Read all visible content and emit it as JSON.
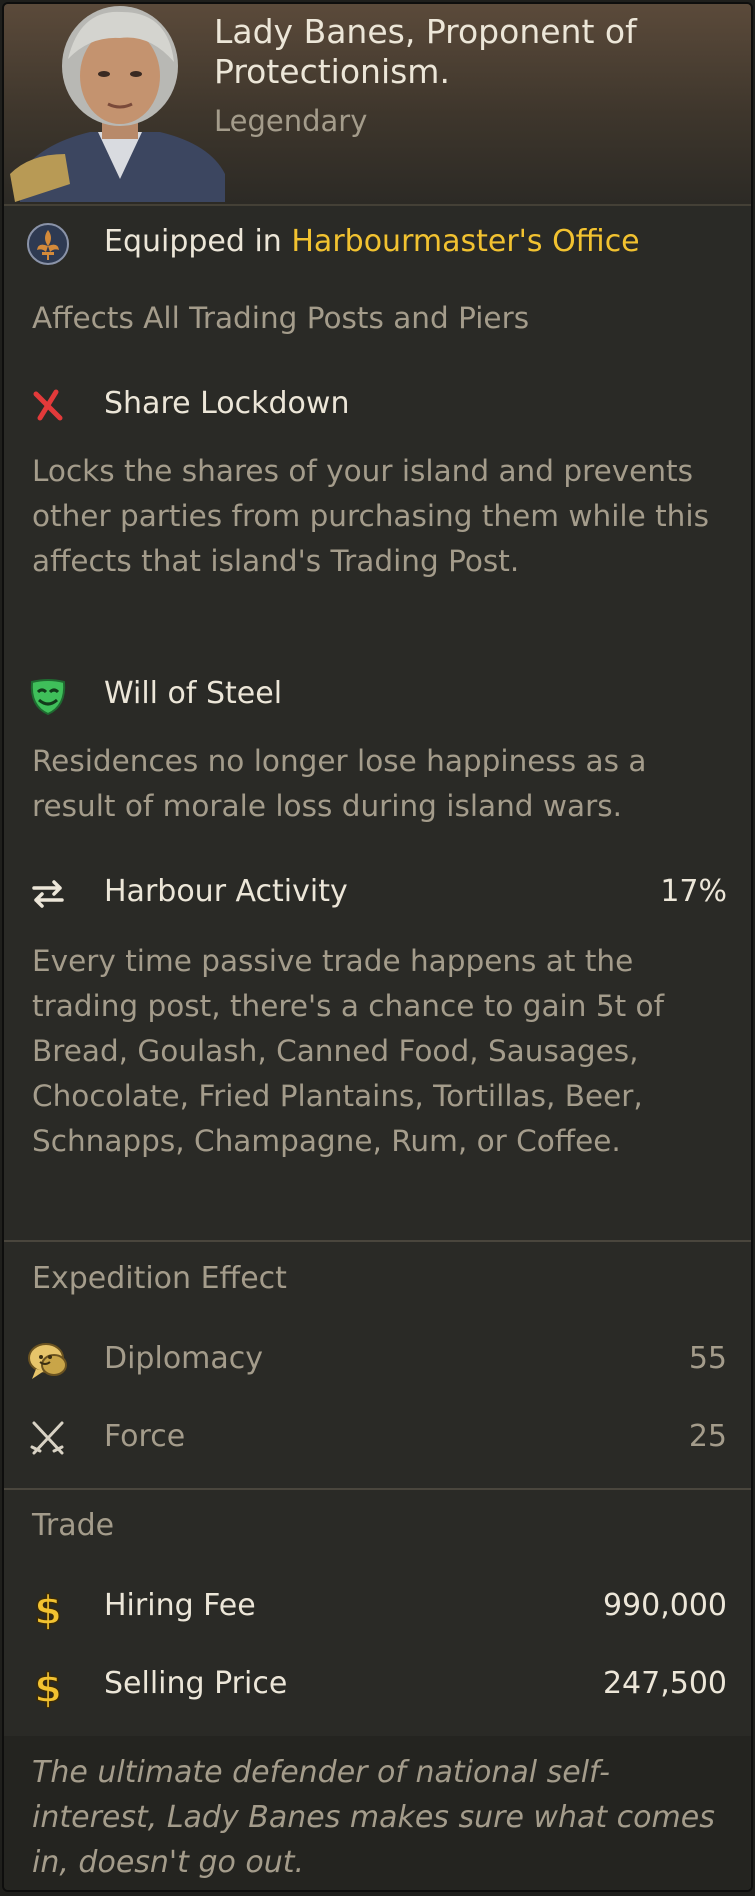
{
  "header": {
    "name": "Lady Banes, Proponent of Protectionism.",
    "rarity": "Legendary"
  },
  "equipped": {
    "prefix": "Equipped in",
    "building": "Harbourmaster's Office",
    "icon": "fleur-de-lis-icon"
  },
  "affects": "Affects All Trading Posts and Piers",
  "abilities": [
    {
      "name": "Share Lockdown",
      "icon": "crossed-out-icon",
      "description": "Locks the shares of your island and prevents other parties from purchasing them while this affects that island's Trading Post."
    },
    {
      "name": "Will of Steel",
      "icon": "happy-mask-icon",
      "description": "Residences no longer lose happiness as a result of morale loss during island wars."
    },
    {
      "name": "Harbour Activity",
      "icon": "trade-arrows-icon",
      "value": "17%",
      "description": "Every time passive trade happens at the trading post, there's a chance to gain 5t of Bread, Goulash, Canned Food, Sausages, Chocolate, Fried Plantains, Tortillas, Beer, Schnapps, Champagne, Rum, or Coffee."
    }
  ],
  "expedition": {
    "title": "Expedition Effect",
    "stats": [
      {
        "name": "Diplomacy",
        "value": "55",
        "icon": "speech-bubble-icon"
      },
      {
        "name": "Force",
        "value": "25",
        "icon": "crossed-swords-icon"
      }
    ]
  },
  "trade": {
    "title": "Trade",
    "items": [
      {
        "name": "Hiring Fee",
        "value": "990,000",
        "icon": "dollar-icon"
      },
      {
        "name": "Selling Price",
        "value": "247,500",
        "icon": "dollar-icon"
      }
    ]
  },
  "lore": "The ultimate defender of national self-interest, Lady Banes makes sure what comes in, doesn't go out.",
  "colors": {
    "highlight": "#f2c230",
    "text": "#ece6d8",
    "muted": "#a49c8b",
    "background": "#2a2a26"
  }
}
